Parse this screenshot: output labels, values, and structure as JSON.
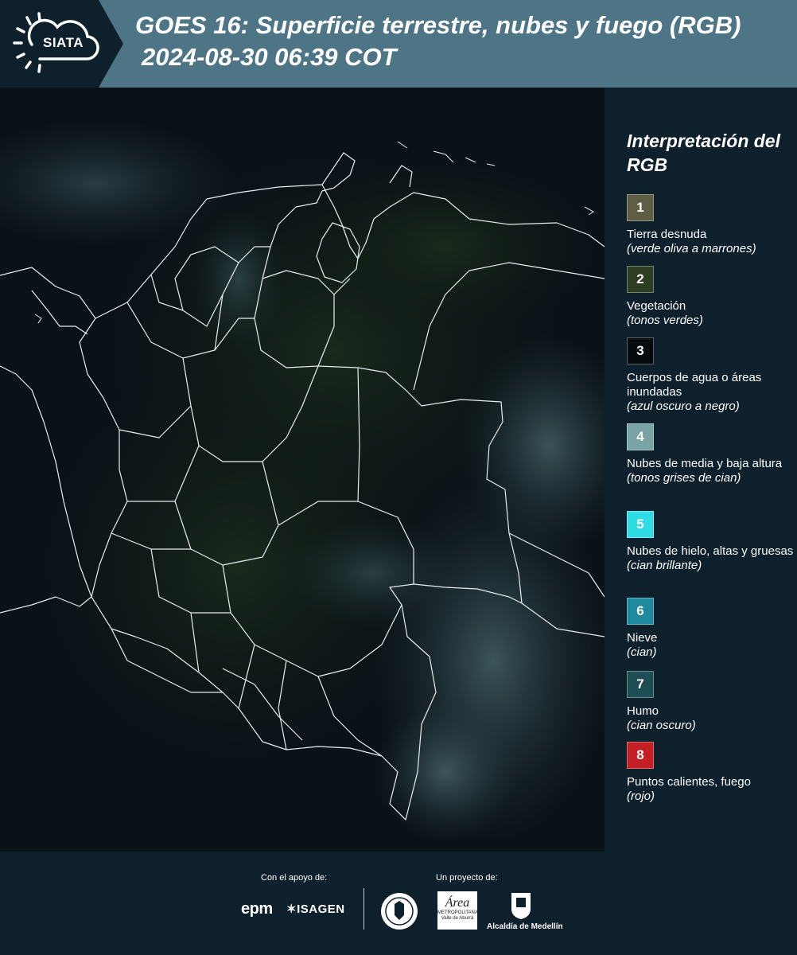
{
  "header": {
    "logo_text": "SIATA",
    "title_line1": "GOES 16: Superficie terrestre, nubes y fuego (RGB)",
    "title_line2": "2024-08-30 06:39 COT",
    "colors": {
      "bar": "#4e7585",
      "logo_panel": "#0e202c"
    }
  },
  "legend": {
    "title": "Interpretación del RGB",
    "items": [
      {
        "number": "1",
        "label": "Tierra desnuda",
        "desc": "(verde oliva a marrones)",
        "color": "#5d5e43"
      },
      {
        "number": "2",
        "label": "Vegetación",
        "desc": "(tonos verdes)",
        "color": "#2d3e22"
      },
      {
        "number": "3",
        "label": "Cuerpos de agua o áreas inundadas",
        "desc": "(azul oscuro a negro)",
        "color": "#060b10"
      },
      {
        "number": "4",
        "label": "Nubes de media y baja altura",
        "desc": "(tonos grises de cian)",
        "color": "#7aa3a5"
      },
      {
        "number": "5",
        "label": "Nubes de hielo, altas y gruesas",
        "desc": "(cian brillante)",
        "color": "#2fdce3"
      },
      {
        "number": "6",
        "label": "Nieve",
        "desc": "(cian)",
        "color": "#1f8a9e"
      },
      {
        "number": "7",
        "label": "Humo",
        "desc": "(cian oscuro)",
        "color": "#1e4e53"
      },
      {
        "number": "8",
        "label": "Puntos calientes, fuego",
        "desc": "(rojo)",
        "color": "#c41f25"
      }
    ]
  },
  "footer": {
    "support_label": "Con el apoyo de:",
    "project_label": "Un proyecto de:",
    "epm": "epm",
    "isagen": "ISAGEN",
    "area_big": "Área",
    "area_small": "METROPOLITANA Valle de Aburrá",
    "alcaldia": "Alcaldía de Medellín"
  }
}
